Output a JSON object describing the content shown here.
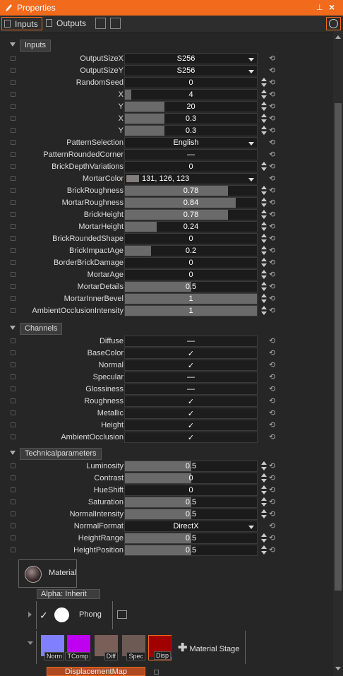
{
  "titlebar": {
    "title": "Properties",
    "pin_icon": "pin-icon",
    "close_icon": "close-icon",
    "close_glyph": "×",
    "pin_glyph": "⊥"
  },
  "toolbar": {
    "tabs": [
      {
        "label": "Inputs",
        "active": true
      },
      {
        "label": "Outputs",
        "active": false
      }
    ]
  },
  "colors": {
    "accent": "#f26a1b",
    "background": "#262626",
    "field_fill": "#6a6a6a"
  },
  "sections": {
    "inputs": "Inputs",
    "channels": "Channels",
    "technical": "Technicalparameters"
  },
  "inputs": [
    {
      "label": "OutputSizeX",
      "type": "dropdown",
      "value": "S256"
    },
    {
      "label": "OutputSizeY",
      "type": "dropdown",
      "value": "S256"
    },
    {
      "label": "RandomSeed",
      "type": "number",
      "value": "0",
      "fill": 0,
      "spin": true
    },
    {
      "label": "X",
      "type": "number",
      "value": "4",
      "fill": 0.05,
      "spin": true
    },
    {
      "label": "Y",
      "type": "number",
      "value": "20",
      "fill": 0.3,
      "spin": true
    },
    {
      "label": "X",
      "type": "number",
      "value": "0.3",
      "fill": 0.3,
      "spin": true
    },
    {
      "label": "Y",
      "type": "number",
      "value": "0.3",
      "fill": 0.3,
      "spin": true
    },
    {
      "label": "PatternSelection",
      "type": "dropdown",
      "value": "English"
    },
    {
      "label": "PatternRoundedCorner",
      "type": "check",
      "value": "—"
    },
    {
      "label": "BrickDepthVariations",
      "type": "number",
      "value": "0",
      "fill": 0,
      "spin": true
    },
    {
      "label": "MortarColor",
      "type": "color",
      "value": "131, 126, 123",
      "swatch": "#837e7b"
    },
    {
      "label": "BrickRoughness",
      "type": "number",
      "value": "0.78",
      "fill": 0.78,
      "spin": true
    },
    {
      "label": "MortarRoughness",
      "type": "number",
      "value": "0.84",
      "fill": 0.84,
      "spin": true
    },
    {
      "label": "BrickHeight",
      "type": "number",
      "value": "0.78",
      "fill": 0.78,
      "spin": true
    },
    {
      "label": "MortarHeight",
      "type": "number",
      "value": "0.24",
      "fill": 0.24,
      "spin": true
    },
    {
      "label": "BrickRoundedShape",
      "type": "number",
      "value": "0",
      "fill": 0,
      "spin": true
    },
    {
      "label": "BrickImpactAge",
      "type": "number",
      "value": "0.2",
      "fill": 0.2,
      "spin": true
    },
    {
      "label": "BorderBrickDamage",
      "type": "number",
      "value": "0",
      "fill": 0,
      "spin": true
    },
    {
      "label": "MortarAge",
      "type": "number",
      "value": "0",
      "fill": 0,
      "spin": true
    },
    {
      "label": "MortarDetails",
      "type": "number",
      "value": "0.5",
      "fill": 0.5,
      "spin": true
    },
    {
      "label": "MortarInnerBevel",
      "type": "number",
      "value": "1",
      "fill": 1,
      "spin": true
    },
    {
      "label": "AmbientOcclusionIntensity",
      "type": "number",
      "value": "1",
      "fill": 1,
      "spin": true
    }
  ],
  "channels": [
    {
      "label": "Diffuse",
      "type": "check",
      "value": "—"
    },
    {
      "label": "BaseColor",
      "type": "check",
      "value": "✓"
    },
    {
      "label": "Normal",
      "type": "check",
      "value": "✓"
    },
    {
      "label": "Specular",
      "type": "check",
      "value": "—"
    },
    {
      "label": "Glossiness",
      "type": "check",
      "value": "—"
    },
    {
      "label": "Roughness",
      "type": "check",
      "value": "✓"
    },
    {
      "label": "Metallic",
      "type": "check",
      "value": "✓"
    },
    {
      "label": "Height",
      "type": "check",
      "value": "✓"
    },
    {
      "label": "AmbientOcclusion",
      "type": "check",
      "value": "✓"
    }
  ],
  "technical": [
    {
      "label": "Luminosity",
      "type": "number",
      "value": "0.5",
      "fill": 0.5,
      "spin": true
    },
    {
      "label": "Contrast",
      "type": "number",
      "value": "0",
      "fill": 0.5,
      "spin": true
    },
    {
      "label": "HueShift",
      "type": "number",
      "value": "0",
      "fill": 0,
      "spin": true
    },
    {
      "label": "Saturation",
      "type": "number",
      "value": "0.5",
      "fill": 0.5,
      "spin": true
    },
    {
      "label": "NormalIntensity",
      "type": "number",
      "value": "0.5",
      "fill": 0.5,
      "spin": true
    },
    {
      "label": "NormalFormat",
      "type": "dropdown",
      "value": "DirectX"
    },
    {
      "label": "HeightRange",
      "type": "number",
      "value": "0.5",
      "fill": 0.5,
      "spin": true
    },
    {
      "label": "HeightPosition",
      "type": "number",
      "value": "0.5",
      "fill": 0.5,
      "spin": true
    }
  ],
  "reset_glyph": "⟲",
  "material": {
    "label": "Material",
    "alpha": "Alpha:  Inherit",
    "shader": "Phong",
    "shader_check": "✓",
    "add_stage": "Material Stage",
    "add_glyph": "✚",
    "thumbnails": [
      {
        "label": "Norm",
        "color": "#8080ff"
      },
      {
        "label": "TComp",
        "color": "#c000f0"
      },
      {
        "label": "Diff",
        "color": "#7a5e58"
      },
      {
        "label": "Spec",
        "color": "#6e5a55"
      },
      {
        "label": "Disp",
        "color": "#a00000"
      }
    ],
    "bottom_button": "DisplacementMap"
  }
}
